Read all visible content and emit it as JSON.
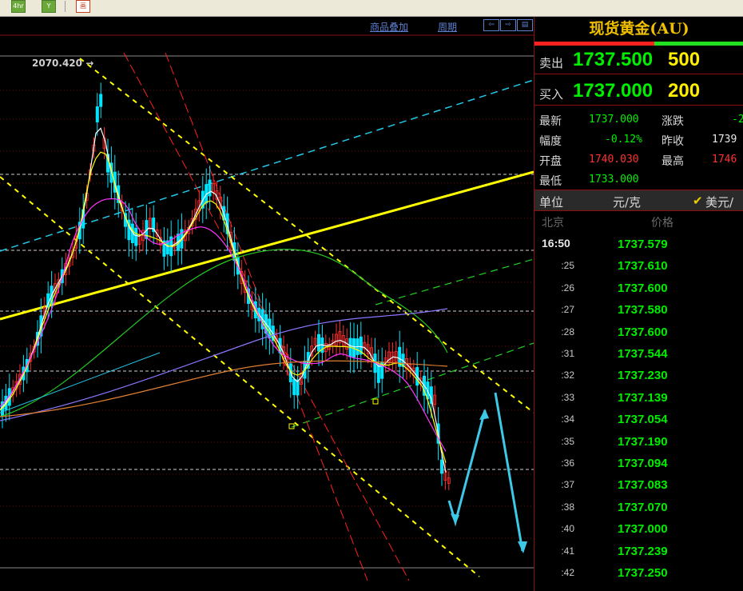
{
  "toolbar": {
    "btn1_label": "4hr",
    "btn2_label": "Y",
    "btn3_label": "画"
  },
  "chart": {
    "menu_overlay": "商品叠加",
    "menu_period": "周期",
    "nav_icons": [
      "arrow-left-icon",
      "arrow-right-icon",
      "panel-icon"
    ],
    "high_label": "2070.420",
    "colors": {
      "up_candle": "#00e5ff",
      "down_candle": "#ff3030",
      "trend_yellow": "#ffff00",
      "channel_cyan": "#22c8e8",
      "channel_green": "#20d020",
      "channel_red": "#ff2020",
      "arrow": "#3ec8e8"
    }
  },
  "panel": {
    "title": "现货黄金(AU)",
    "sell": {
      "label": "卖出",
      "price": "1737.500",
      "volume": "500"
    },
    "buy": {
      "label": "买入",
      "price": "1737.000",
      "volume": "200"
    },
    "stats": [
      {
        "label": "最新",
        "value": "1737.000",
        "label2": "涨跌",
        "value2": "-2"
      },
      {
        "label": "幅度",
        "value": "-0.12%",
        "label2": "昨收",
        "value2": "1739"
      },
      {
        "label": "开盘",
        "value": "1740.030",
        "label2": "最高",
        "value2": "1746"
      },
      {
        "label": "最低",
        "value": "1733.000"
      }
    ],
    "unit": {
      "label": "单位",
      "value": "元/克",
      "alt": "美元/"
    },
    "tick_header": {
      "time": "北京",
      "price": "价格"
    },
    "ticks": [
      {
        "time": "16:50",
        "price": "1737.579"
      },
      {
        "time": ":25",
        "price": "1737.610"
      },
      {
        "time": ":26",
        "price": "1737.600"
      },
      {
        "time": ":27",
        "price": "1737.580"
      },
      {
        "time": ":28",
        "price": "1737.600"
      },
      {
        "time": ":31",
        "price": "1737.544"
      },
      {
        "time": ":32",
        "price": "1737.230"
      },
      {
        "time": ":33",
        "price": "1737.139"
      },
      {
        "time": ":34",
        "price": "1737.054"
      },
      {
        "time": ":35",
        "price": "1737.190"
      },
      {
        "time": ":36",
        "price": "1737.094"
      },
      {
        "time": ":37",
        "price": "1737.083"
      },
      {
        "time": ":38",
        "price": "1737.070"
      },
      {
        "time": ":40",
        "price": "1737.000"
      },
      {
        "time": ":41",
        "price": "1737.239"
      },
      {
        "time": ":42",
        "price": "1737.250"
      }
    ]
  }
}
